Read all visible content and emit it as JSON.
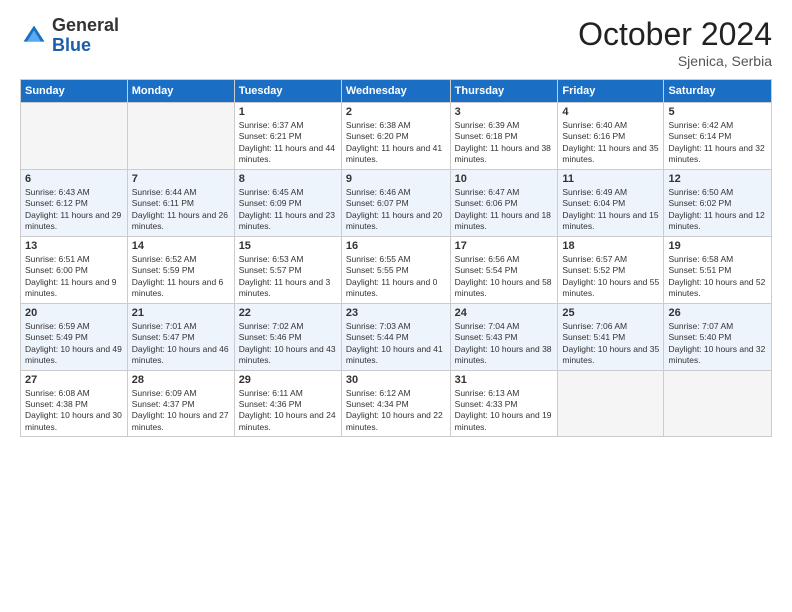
{
  "logo": {
    "general": "General",
    "blue": "Blue"
  },
  "header": {
    "month": "October 2024",
    "location": "Sjenica, Serbia"
  },
  "weekdays": [
    "Sunday",
    "Monday",
    "Tuesday",
    "Wednesday",
    "Thursday",
    "Friday",
    "Saturday"
  ],
  "weeks": [
    [
      {
        "day": "",
        "empty": true
      },
      {
        "day": "",
        "empty": true
      },
      {
        "day": "1",
        "sunrise": "6:37 AM",
        "sunset": "6:21 PM",
        "daylight": "11 hours and 44 minutes."
      },
      {
        "day": "2",
        "sunrise": "6:38 AM",
        "sunset": "6:20 PM",
        "daylight": "11 hours and 41 minutes."
      },
      {
        "day": "3",
        "sunrise": "6:39 AM",
        "sunset": "6:18 PM",
        "daylight": "11 hours and 38 minutes."
      },
      {
        "day": "4",
        "sunrise": "6:40 AM",
        "sunset": "6:16 PM",
        "daylight": "11 hours and 35 minutes."
      },
      {
        "day": "5",
        "sunrise": "6:42 AM",
        "sunset": "6:14 PM",
        "daylight": "11 hours and 32 minutes."
      }
    ],
    [
      {
        "day": "6",
        "sunrise": "6:43 AM",
        "sunset": "6:12 PM",
        "daylight": "11 hours and 29 minutes."
      },
      {
        "day": "7",
        "sunrise": "6:44 AM",
        "sunset": "6:11 PM",
        "daylight": "11 hours and 26 minutes."
      },
      {
        "day": "8",
        "sunrise": "6:45 AM",
        "sunset": "6:09 PM",
        "daylight": "11 hours and 23 minutes."
      },
      {
        "day": "9",
        "sunrise": "6:46 AM",
        "sunset": "6:07 PM",
        "daylight": "11 hours and 20 minutes."
      },
      {
        "day": "10",
        "sunrise": "6:47 AM",
        "sunset": "6:06 PM",
        "daylight": "11 hours and 18 minutes."
      },
      {
        "day": "11",
        "sunrise": "6:49 AM",
        "sunset": "6:04 PM",
        "daylight": "11 hours and 15 minutes."
      },
      {
        "day": "12",
        "sunrise": "6:50 AM",
        "sunset": "6:02 PM",
        "daylight": "11 hours and 12 minutes."
      }
    ],
    [
      {
        "day": "13",
        "sunrise": "6:51 AM",
        "sunset": "6:00 PM",
        "daylight": "11 hours and 9 minutes."
      },
      {
        "day": "14",
        "sunrise": "6:52 AM",
        "sunset": "5:59 PM",
        "daylight": "11 hours and 6 minutes."
      },
      {
        "day": "15",
        "sunrise": "6:53 AM",
        "sunset": "5:57 PM",
        "daylight": "11 hours and 3 minutes."
      },
      {
        "day": "16",
        "sunrise": "6:55 AM",
        "sunset": "5:55 PM",
        "daylight": "11 hours and 0 minutes."
      },
      {
        "day": "17",
        "sunrise": "6:56 AM",
        "sunset": "5:54 PM",
        "daylight": "10 hours and 58 minutes."
      },
      {
        "day": "18",
        "sunrise": "6:57 AM",
        "sunset": "5:52 PM",
        "daylight": "10 hours and 55 minutes."
      },
      {
        "day": "19",
        "sunrise": "6:58 AM",
        "sunset": "5:51 PM",
        "daylight": "10 hours and 52 minutes."
      }
    ],
    [
      {
        "day": "20",
        "sunrise": "6:59 AM",
        "sunset": "5:49 PM",
        "daylight": "10 hours and 49 minutes."
      },
      {
        "day": "21",
        "sunrise": "7:01 AM",
        "sunset": "5:47 PM",
        "daylight": "10 hours and 46 minutes."
      },
      {
        "day": "22",
        "sunrise": "7:02 AM",
        "sunset": "5:46 PM",
        "daylight": "10 hours and 43 minutes."
      },
      {
        "day": "23",
        "sunrise": "7:03 AM",
        "sunset": "5:44 PM",
        "daylight": "10 hours and 41 minutes."
      },
      {
        "day": "24",
        "sunrise": "7:04 AM",
        "sunset": "5:43 PM",
        "daylight": "10 hours and 38 minutes."
      },
      {
        "day": "25",
        "sunrise": "7:06 AM",
        "sunset": "5:41 PM",
        "daylight": "10 hours and 35 minutes."
      },
      {
        "day": "26",
        "sunrise": "7:07 AM",
        "sunset": "5:40 PM",
        "daylight": "10 hours and 32 minutes."
      }
    ],
    [
      {
        "day": "27",
        "sunrise": "6:08 AM",
        "sunset": "4:38 PM",
        "daylight": "10 hours and 30 minutes."
      },
      {
        "day": "28",
        "sunrise": "6:09 AM",
        "sunset": "4:37 PM",
        "daylight": "10 hours and 27 minutes."
      },
      {
        "day": "29",
        "sunrise": "6:11 AM",
        "sunset": "4:36 PM",
        "daylight": "10 hours and 24 minutes."
      },
      {
        "day": "30",
        "sunrise": "6:12 AM",
        "sunset": "4:34 PM",
        "daylight": "10 hours and 22 minutes."
      },
      {
        "day": "31",
        "sunrise": "6:13 AM",
        "sunset": "4:33 PM",
        "daylight": "10 hours and 19 minutes."
      },
      {
        "day": "",
        "empty": true
      },
      {
        "day": "",
        "empty": true
      }
    ]
  ]
}
